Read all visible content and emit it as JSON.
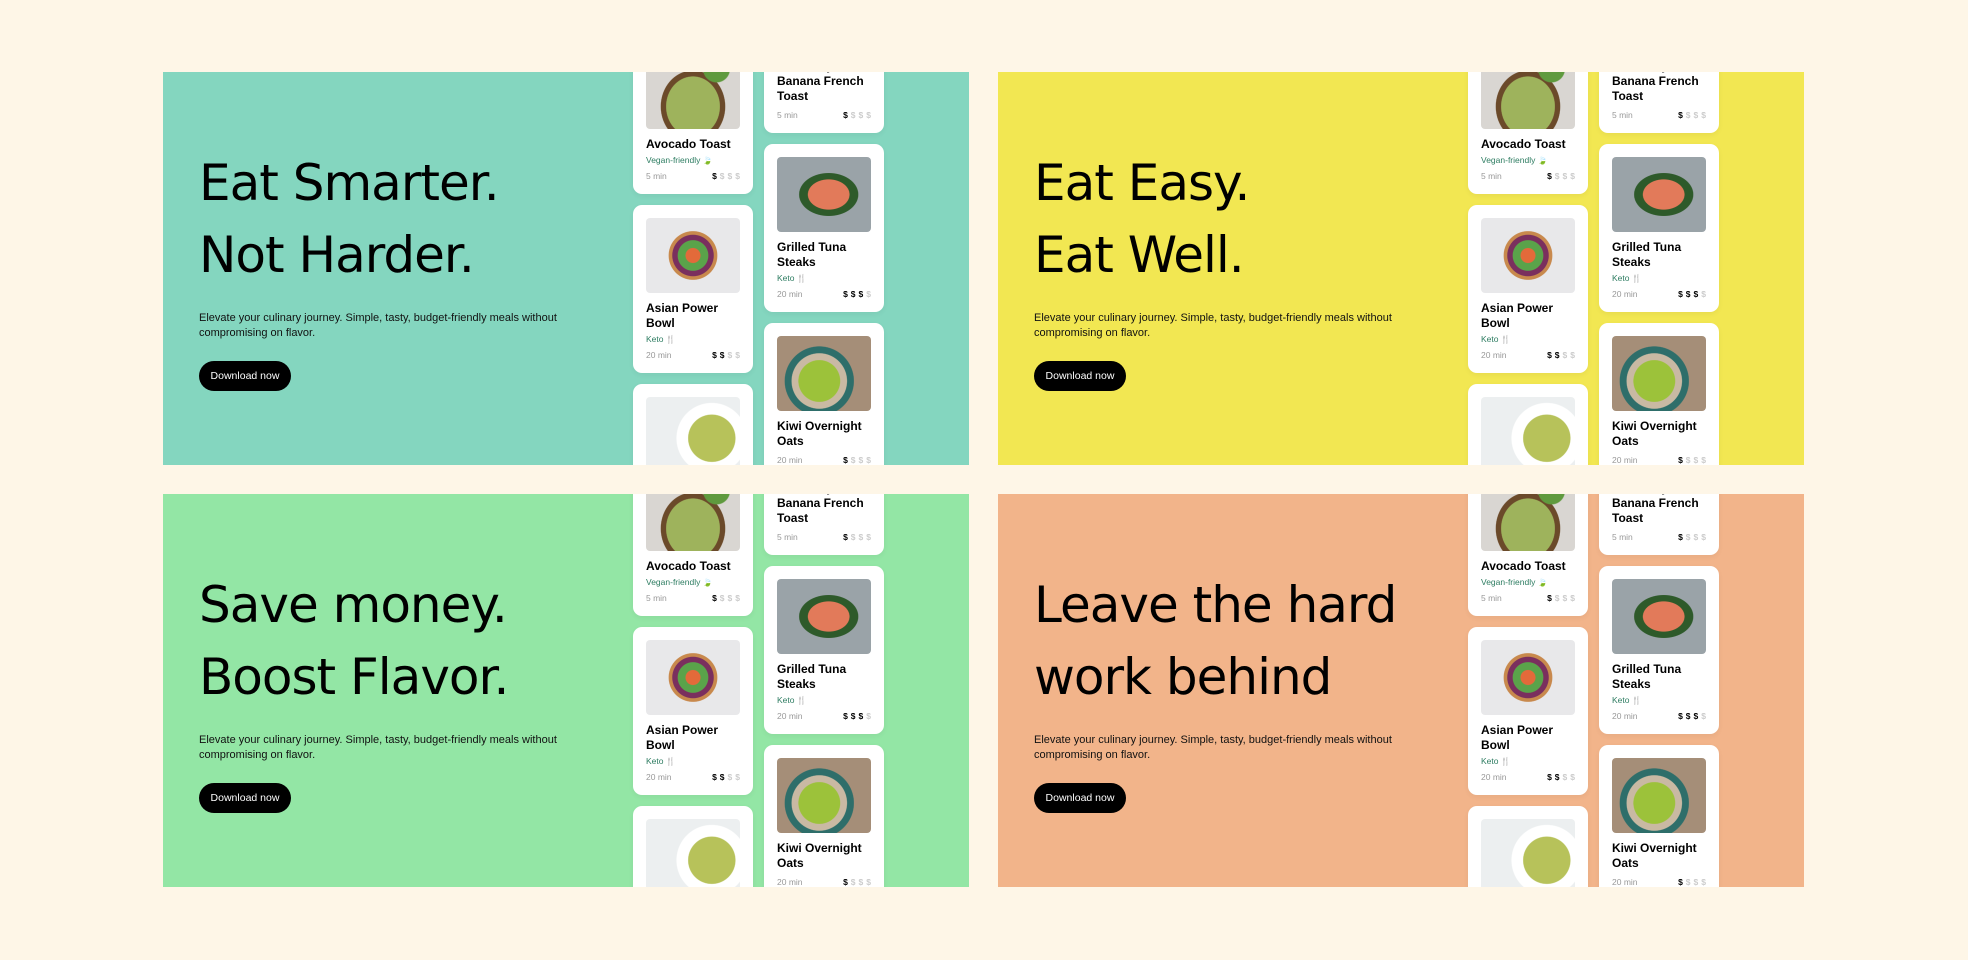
{
  "panels": [
    {
      "bg": "#84d6bf",
      "headline": [
        "Eat Smarter.",
        "Not Harder."
      ],
      "subtitle": "Elevate your culinary journey. Simple, tasty, budget-friendly meals without compromising on flavor.",
      "button": "Download now"
    },
    {
      "bg": "#f2e752",
      "headline": [
        "Eat Easy.",
        "Eat Well."
      ],
      "subtitle": "Elevate your culinary journey. Simple, tasty, budget-friendly meals without compromising on flavor.",
      "button": "Download now"
    },
    {
      "bg": "#93e6a5",
      "headline": [
        "Save money.",
        "Boost Flavor."
      ],
      "subtitle": "Elevate your culinary journey. Simple, tasty, budget-friendly meals without compromising on flavor.",
      "button": "Download now"
    },
    {
      "bg": "#f2b48a",
      "headline": [
        "Leave the hard",
        "work behind"
      ],
      "subtitle": "Elevate your culinary journey. Simple, tasty, budget-friendly meals without compromising on flavor.",
      "button": "Download now"
    }
  ],
  "columns": [
    [
      {
        "image": "avocado",
        "title": "Avocado Toast",
        "tag": "Vegan-friendly",
        "tag_icon": "leaf-icon",
        "time": "5 min",
        "price_level": 1
      },
      {
        "image": "bowl",
        "title": "Asian Power Bowl",
        "tag": "Keto",
        "tag_icon": "fork-knife-icon",
        "time": "20 min",
        "price_level": 2
      },
      {
        "image": "pasta",
        "title": "",
        "tag": "",
        "time": "",
        "price_level": 0
      }
    ],
    [
      {
        "image": "toast",
        "title": "Blueberry & Banana French Toast",
        "tag": "",
        "time": "5 min",
        "price_level": 1
      },
      {
        "image": "tuna",
        "title": "Grilled Tuna Steaks",
        "tag": "Keto",
        "tag_icon": "fork-knife-icon",
        "time": "20 min",
        "price_level": 3
      },
      {
        "image": "oats",
        "title": "Kiwi Overnight Oats",
        "tag": "",
        "time": "20 min",
        "price_level": 1
      }
    ]
  ],
  "price_symbol": "$"
}
